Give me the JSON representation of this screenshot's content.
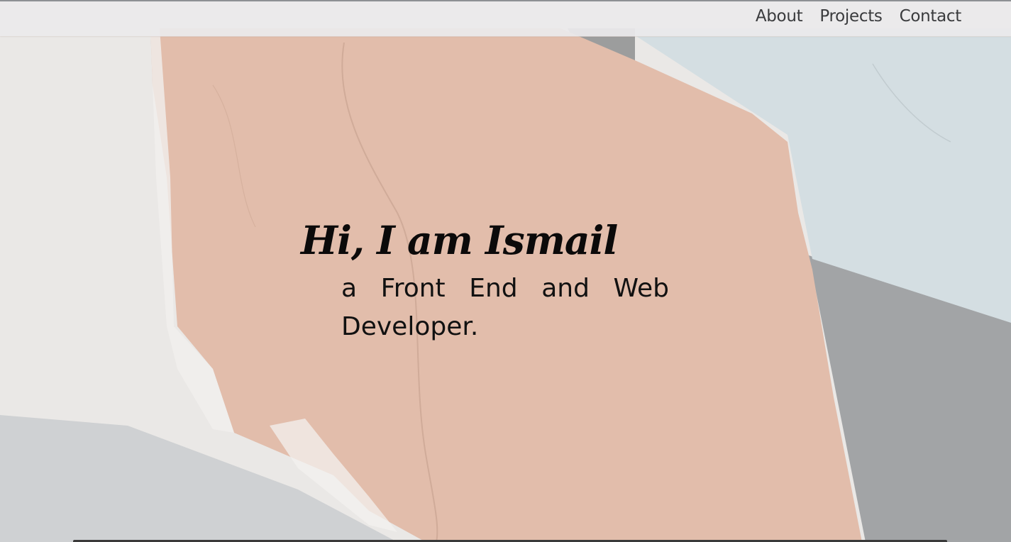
{
  "nav": {
    "items": [
      {
        "label": "About"
      },
      {
        "label": "Projects"
      },
      {
        "label": "Contact"
      }
    ]
  },
  "hero": {
    "title": "Hi, I am Ismail",
    "subtitle": "a Front End and Web Developer."
  },
  "colors": {
    "peach": "#e2bdab",
    "light_blue": "#d3dde1",
    "gray": "#9fa2a5",
    "off_white": "#ebe9e7",
    "text": "#0b0a0a"
  }
}
